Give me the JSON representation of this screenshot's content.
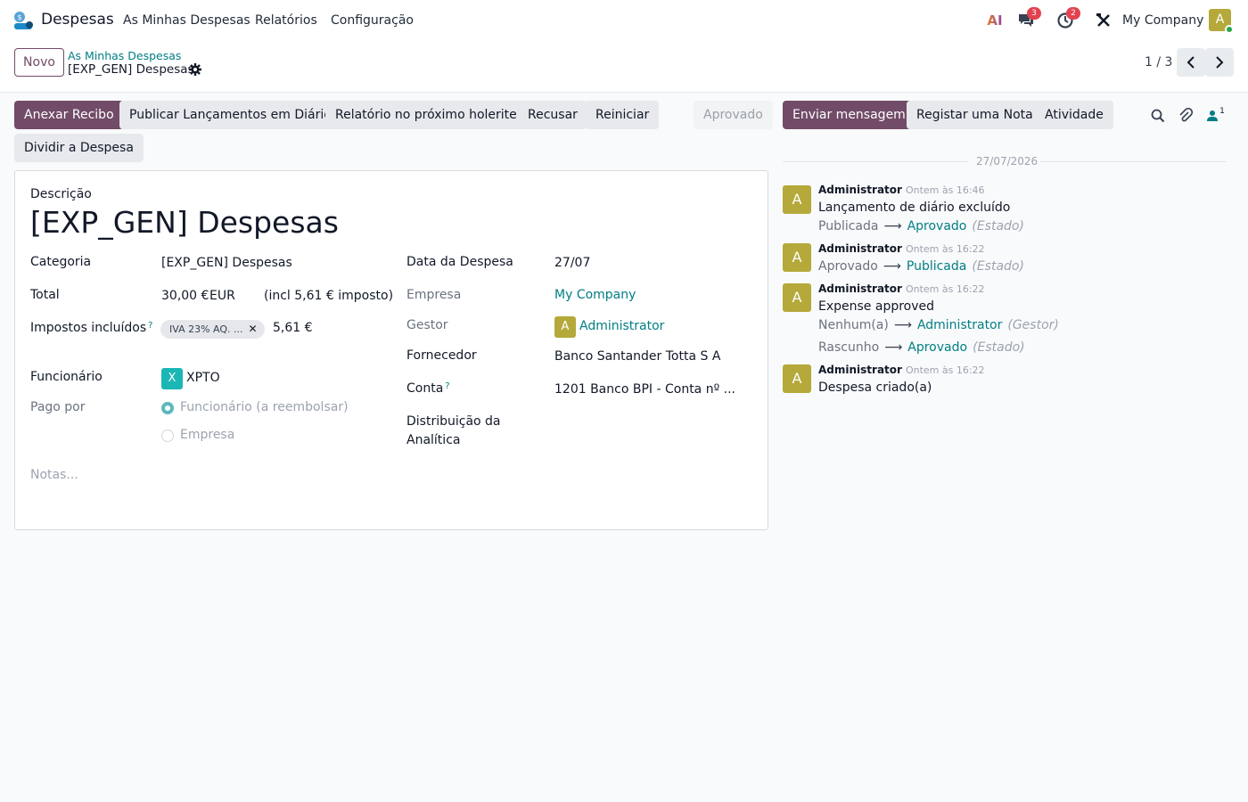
{
  "navbar": {
    "app_name": "Despesas",
    "menus": [
      "As Minhas Despesas",
      "Relatórios",
      "Configuração"
    ],
    "ai_label": "AI",
    "messages_badge": "3",
    "activities_badge": "2",
    "company": "My Company",
    "user_initial": "A"
  },
  "controlbar": {
    "new_label": "Novo",
    "breadcrumb_parent": "As Minhas Despesas",
    "breadcrumb_current": "[EXP_GEN] Despesas",
    "pager_value": "1 / 3"
  },
  "statusbar": {
    "buttons": [
      "Anexar Recibo",
      "Publicar Lançamentos em Diário",
      "Relatório no próximo holerite",
      "Recusar",
      "Reiniciar",
      "Dividir a Despesa"
    ],
    "status": "Aprovado"
  },
  "form": {
    "description_label": "Descrição",
    "title": "[EXP_GEN] Despesas",
    "categoria_label": "Categoria",
    "categoria_value": "[EXP_GEN] Despesas",
    "total_label": "Total",
    "total_amount": "30,00 €",
    "total_currency": "EUR",
    "total_tax_note": "(incl 5,61 € imposto)",
    "taxes_label": "Impostos incluídos",
    "tax_tag": "IVA 23% AQ. ...",
    "tax_amount": "5,61 €",
    "employee_label": "Funcionário",
    "employee_initial": "X",
    "employee_value": "XPTO",
    "paid_by_label": "Pago por",
    "paid_by_options": [
      "Funcionário (a reembolsar)",
      "Empresa"
    ],
    "date_label": "Data da Despesa",
    "date_value": "27/07",
    "company_label": "Empresa",
    "company_value": "My Company",
    "manager_label": "Gestor",
    "manager_initial": "A",
    "manager_value": "Administrator",
    "vendor_label": "Fornecedor",
    "vendor_value": "Banco Santander Totta S A",
    "account_label": "Conta",
    "account_value": "1201 Banco BPI - Conta nº ...",
    "analytic_label_1": "Distribuição da",
    "analytic_label_2": "Analítica",
    "notes_placeholder": "Notas...",
    "help_mark": "?"
  },
  "chatter": {
    "send_message": "Enviar mensagem",
    "log_note": "Registar uma Nota",
    "activity": "Atividade",
    "followers_count": "1",
    "date_separator": "27/07/2026",
    "messages": [
      {
        "initial": "A",
        "author": "Administrator",
        "time": "Ontem às 16:46",
        "body": "Lançamento de diário excluído",
        "old": "Publicada",
        "new": "Aprovado",
        "field": "(Estado)"
      },
      {
        "initial": "A",
        "author": "Administrator",
        "time": "Ontem às 16:22",
        "old": "Aprovado",
        "new": "Publicada",
        "field": "(Estado)"
      },
      {
        "initial": "A",
        "author": "Administrator",
        "time": "Ontem às 16:22",
        "body": "Expense approved",
        "old": "Nenhum(a)",
        "new": "Administrator",
        "field": "(Gestor)",
        "old2": "Rascunho",
        "new2": "Aprovado",
        "field2": "(Estado)"
      },
      {
        "initial": "A",
        "author": "Administrator",
        "time": "Ontem às 16:22",
        "body": "Despesa criado(a)"
      }
    ]
  },
  "colors": {
    "primary": "#714b67",
    "link": "#017e84",
    "badge": "#e3424f",
    "avatar_admin": "#b4a93a",
    "avatar_employee": "#1ab7b5"
  }
}
